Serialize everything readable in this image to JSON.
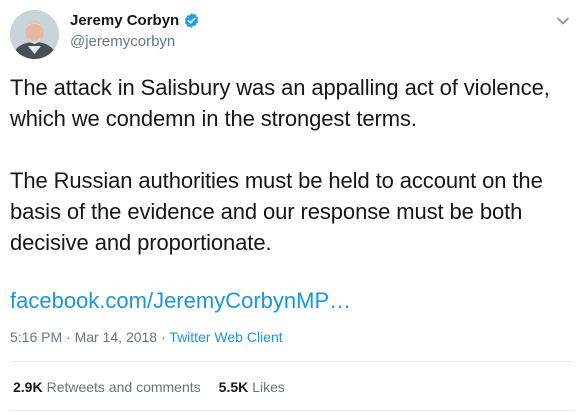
{
  "author": {
    "display_name": "Jeremy Corbyn",
    "handle": "@jeremycorbyn",
    "verified": true
  },
  "tweet": {
    "text": "The attack in Salisbury was an appalling act of violence, which we condemn in the strongest terms.\n\nThe Russian authorities must be held to account on the basis of the evidence and our response must be both decisive and proportionate.",
    "link_text": "facebook.com/JeremyCorbynMP…"
  },
  "meta": {
    "time": "5:16 PM",
    "separator": " · ",
    "date": "Mar 14, 2018",
    "client": "Twitter Web Client"
  },
  "stats": {
    "retweets_count": "2.9K",
    "retweets_label": "Retweets and comments",
    "likes_count": "5.5K",
    "likes_label": "Likes"
  },
  "colors": {
    "accent": "#1b95e0",
    "verified": "#1da1f2",
    "muted": "#657786"
  }
}
